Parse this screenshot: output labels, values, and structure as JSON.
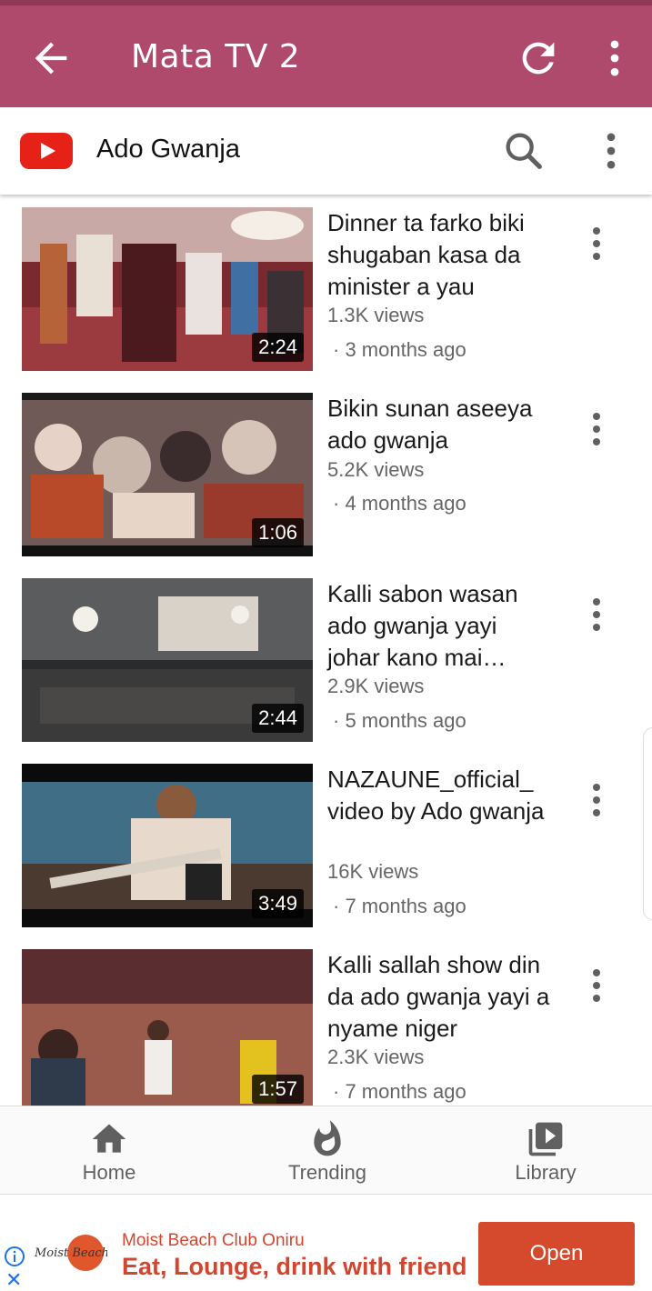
{
  "app_bar": {
    "title": "Mata TV 2",
    "color": "#b04a6d"
  },
  "channel_header": {
    "name": "Ado Gwanja"
  },
  "videos": [
    {
      "title": "Dinner ta farko biki shugaban kasa da minister a yau",
      "views": "1.3K views",
      "ago": "· 3 months ago",
      "duration": "2:24"
    },
    {
      "title": "Bikin sunan aseeya ado gwanja",
      "views": "5.2K views",
      "ago": "· 4 months ago",
      "duration": "1:06"
    },
    {
      "title": "Kalli sabon wasan ado gwanja yayi johar kano mai…",
      "views": "2.9K views",
      "ago": "· 5 months ago",
      "duration": "2:44"
    },
    {
      "title": "NAZAUNE_official_ video by Ado gwanja",
      "views": "16K views",
      "ago": "· 7 months ago",
      "duration": "3:49"
    },
    {
      "title": "Kalli sallah show din da ado gwanja yayi a nyame niger",
      "views": "2.3K views",
      "ago": "· 7 months ago",
      "duration": "1:57"
    }
  ],
  "bottom_nav": [
    {
      "label": "Home",
      "icon": "home-icon"
    },
    {
      "label": "Trending",
      "icon": "flame-icon"
    },
    {
      "label": "Library",
      "icon": "library-icon"
    }
  ],
  "ad": {
    "logo_text": "Moist Beach",
    "brand": "Moist Beach Club Oniru",
    "headline": "Eat, Lounge, drink with friend",
    "button": "Open",
    "close": "✕"
  }
}
